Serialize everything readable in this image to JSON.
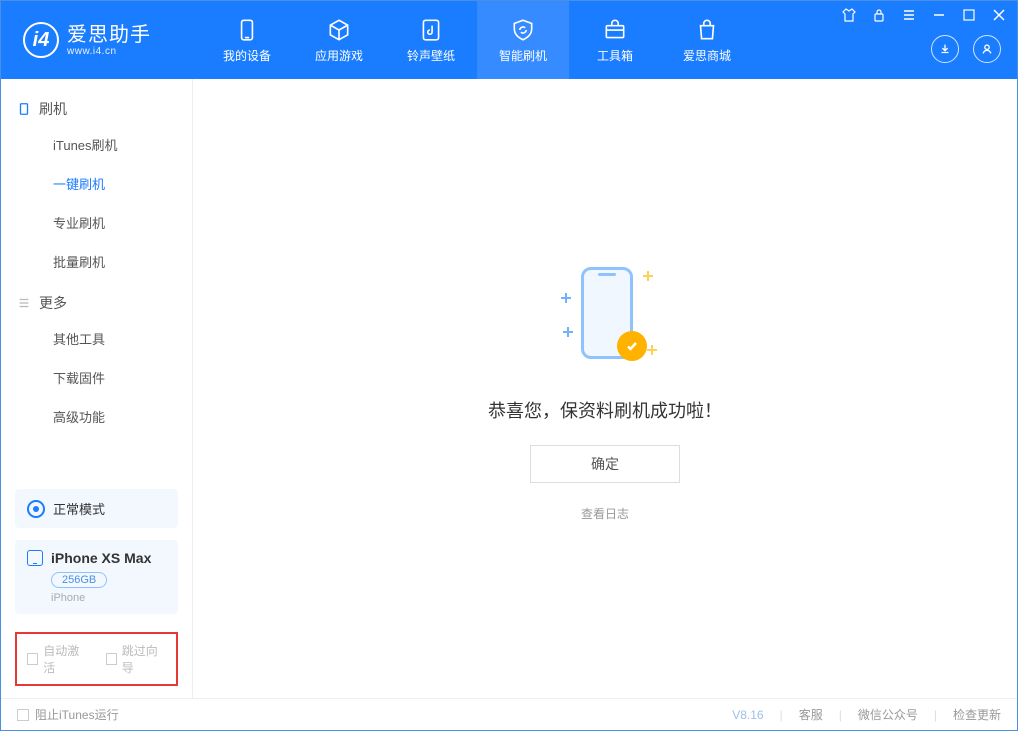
{
  "app": {
    "name": "爱思助手",
    "url": "www.i4.cn"
  },
  "nav": {
    "items": [
      {
        "label": "我的设备"
      },
      {
        "label": "应用游戏"
      },
      {
        "label": "铃声壁纸"
      },
      {
        "label": "智能刷机"
      },
      {
        "label": "工具箱"
      },
      {
        "label": "爱思商城"
      }
    ],
    "active_index": 3
  },
  "sidebar": {
    "groups": [
      {
        "title": "刷机",
        "items": [
          "iTunes刷机",
          "一键刷机",
          "专业刷机",
          "批量刷机"
        ],
        "active_index": 1
      },
      {
        "title": "更多",
        "items": [
          "其他工具",
          "下载固件",
          "高级功能"
        ],
        "active_index": -1
      }
    ],
    "mode": {
      "label": "正常模式"
    },
    "device": {
      "name": "iPhone XS Max",
      "storage": "256GB",
      "subtitle": "iPhone"
    },
    "options": {
      "auto_activate": "自动激活",
      "skip_guide": "跳过向导"
    }
  },
  "main": {
    "success_message": "恭喜您，保资料刷机成功啦！",
    "ok_label": "确定",
    "log_link": "查看日志"
  },
  "statusbar": {
    "block_itunes": "阻止iTunes运行",
    "version": "V8.16",
    "links": [
      "客服",
      "微信公众号",
      "检查更新"
    ]
  }
}
